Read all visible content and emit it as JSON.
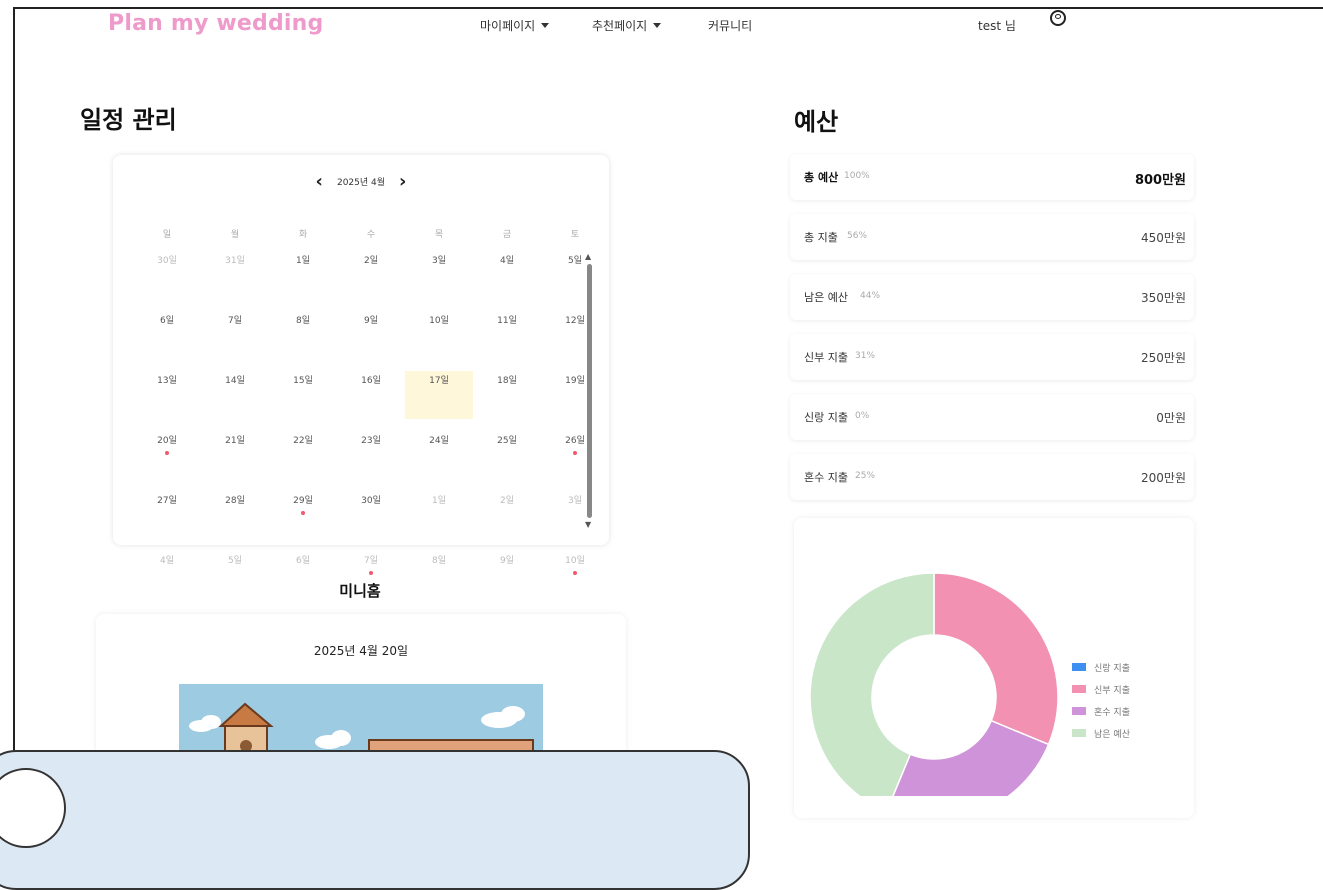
{
  "nav": {
    "brand": "Plan my wedding",
    "menus": [
      {
        "label": "마이페이지",
        "has_dropdown": true
      },
      {
        "label": "추천페이지",
        "has_dropdown": true
      },
      {
        "label": "커뮤니티",
        "has_dropdown": false
      }
    ],
    "user_label": "test 님"
  },
  "schedule": {
    "title": "일정 관리",
    "calendar": {
      "month_label": "2025년 4월",
      "weekdays": [
        "일",
        "월",
        "화",
        "수",
        "목",
        "금",
        "토"
      ],
      "weeks": [
        [
          {
            "d": "30일",
            "dim": true
          },
          {
            "d": "31일",
            "dim": true
          },
          {
            "d": "1일"
          },
          {
            "d": "2일"
          },
          {
            "d": "3일"
          },
          {
            "d": "4일"
          },
          {
            "d": "5일"
          }
        ],
        [
          {
            "d": "6일"
          },
          {
            "d": "7일"
          },
          {
            "d": "8일"
          },
          {
            "d": "9일"
          },
          {
            "d": "10일"
          },
          {
            "d": "11일"
          },
          {
            "d": "12일"
          }
        ],
        [
          {
            "d": "13일"
          },
          {
            "d": "14일"
          },
          {
            "d": "15일"
          },
          {
            "d": "16일"
          },
          {
            "d": "17일",
            "today": true
          },
          {
            "d": "18일"
          },
          {
            "d": "19일"
          }
        ],
        [
          {
            "d": "20일",
            "event": true
          },
          {
            "d": "21일"
          },
          {
            "d": "22일"
          },
          {
            "d": "23일"
          },
          {
            "d": "24일"
          },
          {
            "d": "25일"
          },
          {
            "d": "26일",
            "event": true
          }
        ],
        [
          {
            "d": "27일"
          },
          {
            "d": "28일"
          },
          {
            "d": "29일",
            "event": true
          },
          {
            "d": "30일"
          },
          {
            "d": "1일",
            "dim": true
          },
          {
            "d": "2일",
            "dim": true
          },
          {
            "d": "3일",
            "dim": true
          }
        ],
        [
          {
            "d": "4일",
            "dim": true
          },
          {
            "d": "5일",
            "dim": true
          },
          {
            "d": "6일",
            "dim": true
          },
          {
            "d": "7일",
            "dim": true,
            "event": true
          },
          {
            "d": "8일",
            "dim": true
          },
          {
            "d": "9일",
            "dim": true
          },
          {
            "d": "10일",
            "dim": true,
            "event": true
          }
        ]
      ]
    }
  },
  "minihome": {
    "title": "미니홈",
    "date": "2025년 4월 20일"
  },
  "budget": {
    "title": "예산",
    "rows": [
      {
        "label": "총 예산",
        "pct": "100%",
        "amount": "800만원",
        "bold": true
      },
      {
        "label": "총 지출",
        "pct": "56%",
        "amount": "450만원"
      },
      {
        "label": "남은 예산",
        "pct": "44%",
        "amount": "350만원"
      },
      {
        "label": "신부 지출",
        "pct": "31%",
        "amount": "250만원"
      },
      {
        "label": "신랑 지출",
        "pct": "0%",
        "amount": "0만원"
      },
      {
        "label": "혼수 지출",
        "pct": "25%",
        "amount": "200만원"
      }
    ]
  },
  "chart_data": {
    "type": "pie",
    "donut": true,
    "categories": [
      "신랑 지출",
      "신부 지출",
      "혼수 지출",
      "남은 예산"
    ],
    "values": [
      0,
      250,
      200,
      350
    ],
    "colors": [
      "#3d8ff0",
      "#f291b2",
      "#cf93d9",
      "#c9e6c9"
    ],
    "legend": "right"
  }
}
